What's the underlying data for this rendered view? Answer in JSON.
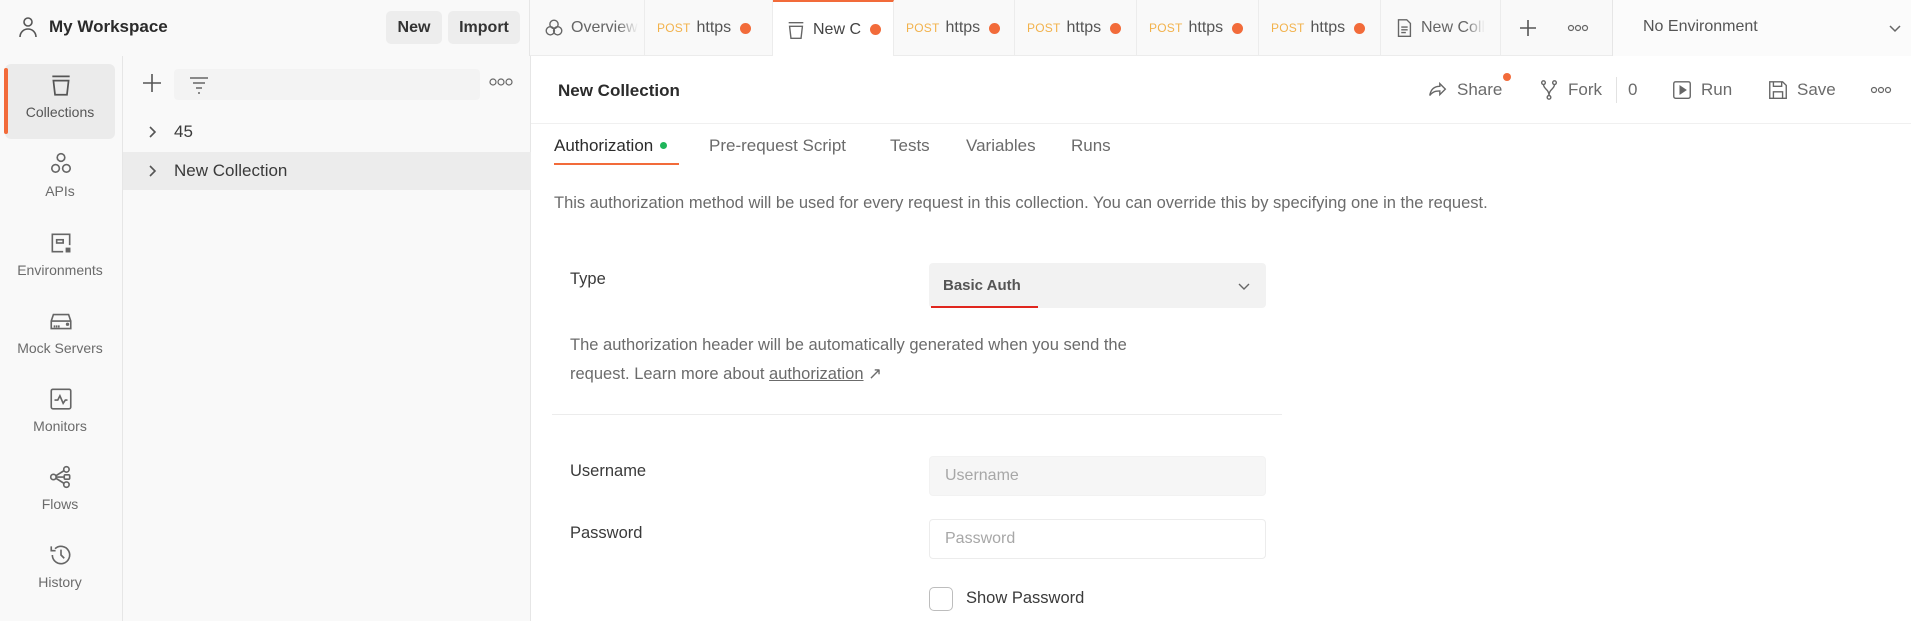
{
  "workspace": {
    "title": "My Workspace",
    "new_label": "New",
    "import_label": "Import"
  },
  "tabs": [
    {
      "label": "Overview",
      "icon": "overview-icon",
      "method": "",
      "unsaved": false,
      "active": false
    },
    {
      "label": "https",
      "method": "POST",
      "unsaved": true,
      "active": false
    },
    {
      "label": "New C",
      "icon": "collection-icon",
      "method": "",
      "unsaved": true,
      "active": true
    },
    {
      "label": "https",
      "method": "POST",
      "unsaved": true,
      "active": false
    },
    {
      "label": "https",
      "method": "POST",
      "unsaved": true,
      "active": false
    },
    {
      "label": "https",
      "method": "POST",
      "unsaved": true,
      "active": false
    },
    {
      "label": "https",
      "method": "POST",
      "unsaved": true,
      "active": false
    },
    {
      "label": "New Coll",
      "icon": "document-icon",
      "method": "",
      "unsaved": false,
      "active": false
    }
  ],
  "environment": {
    "selected": "No Environment"
  },
  "sidebar": {
    "items": [
      {
        "label": "Collections",
        "icon": "collections-icon",
        "active": true
      },
      {
        "label": "APIs",
        "icon": "apis-icon",
        "active": false
      },
      {
        "label": "Environments",
        "icon": "environments-icon",
        "active": false
      },
      {
        "label": "Mock Servers",
        "icon": "mock-servers-icon",
        "active": false
      },
      {
        "label": "Monitors",
        "icon": "monitors-icon",
        "active": false
      },
      {
        "label": "Flows",
        "icon": "flows-icon",
        "active": false
      },
      {
        "label": "History",
        "icon": "history-icon",
        "active": false
      }
    ]
  },
  "collections": {
    "filter_placeholder": "",
    "items": [
      {
        "name": "45",
        "selected": false
      },
      {
        "name": "New Collection",
        "selected": true
      }
    ]
  },
  "main": {
    "title": "New Collection",
    "actions": {
      "share": "Share",
      "fork": "Fork",
      "fork_count": "0",
      "run": "Run",
      "save": "Save"
    },
    "tabs": [
      {
        "label": "Authorization",
        "active": true,
        "indicator": true
      },
      {
        "label": "Pre-request Script",
        "active": false
      },
      {
        "label": "Tests",
        "active": false
      },
      {
        "label": "Variables",
        "active": false
      },
      {
        "label": "Runs",
        "active": false
      }
    ],
    "description": "This authorization method will be used for every request in this collection. You can override this by specifying one in the request.",
    "auth": {
      "type_label": "Type",
      "type_value": "Basic Auth",
      "help_line1": "The authorization header will be automatically generated when you send the",
      "help_line2_prefix": "request. Learn more about ",
      "help_link": "authorization",
      "help_link_arrow": "↗",
      "username_label": "Username",
      "username_value": "",
      "username_placeholder": "Username",
      "password_label": "Password",
      "password_value": "",
      "password_placeholder": "Password",
      "show_password_label": "Show Password",
      "show_password_checked": false
    }
  },
  "colors": {
    "accent": "#f26b3a",
    "post_method": "#f2b24c",
    "success_dot": "#1fb55a",
    "select_underline": "#e0261e"
  }
}
